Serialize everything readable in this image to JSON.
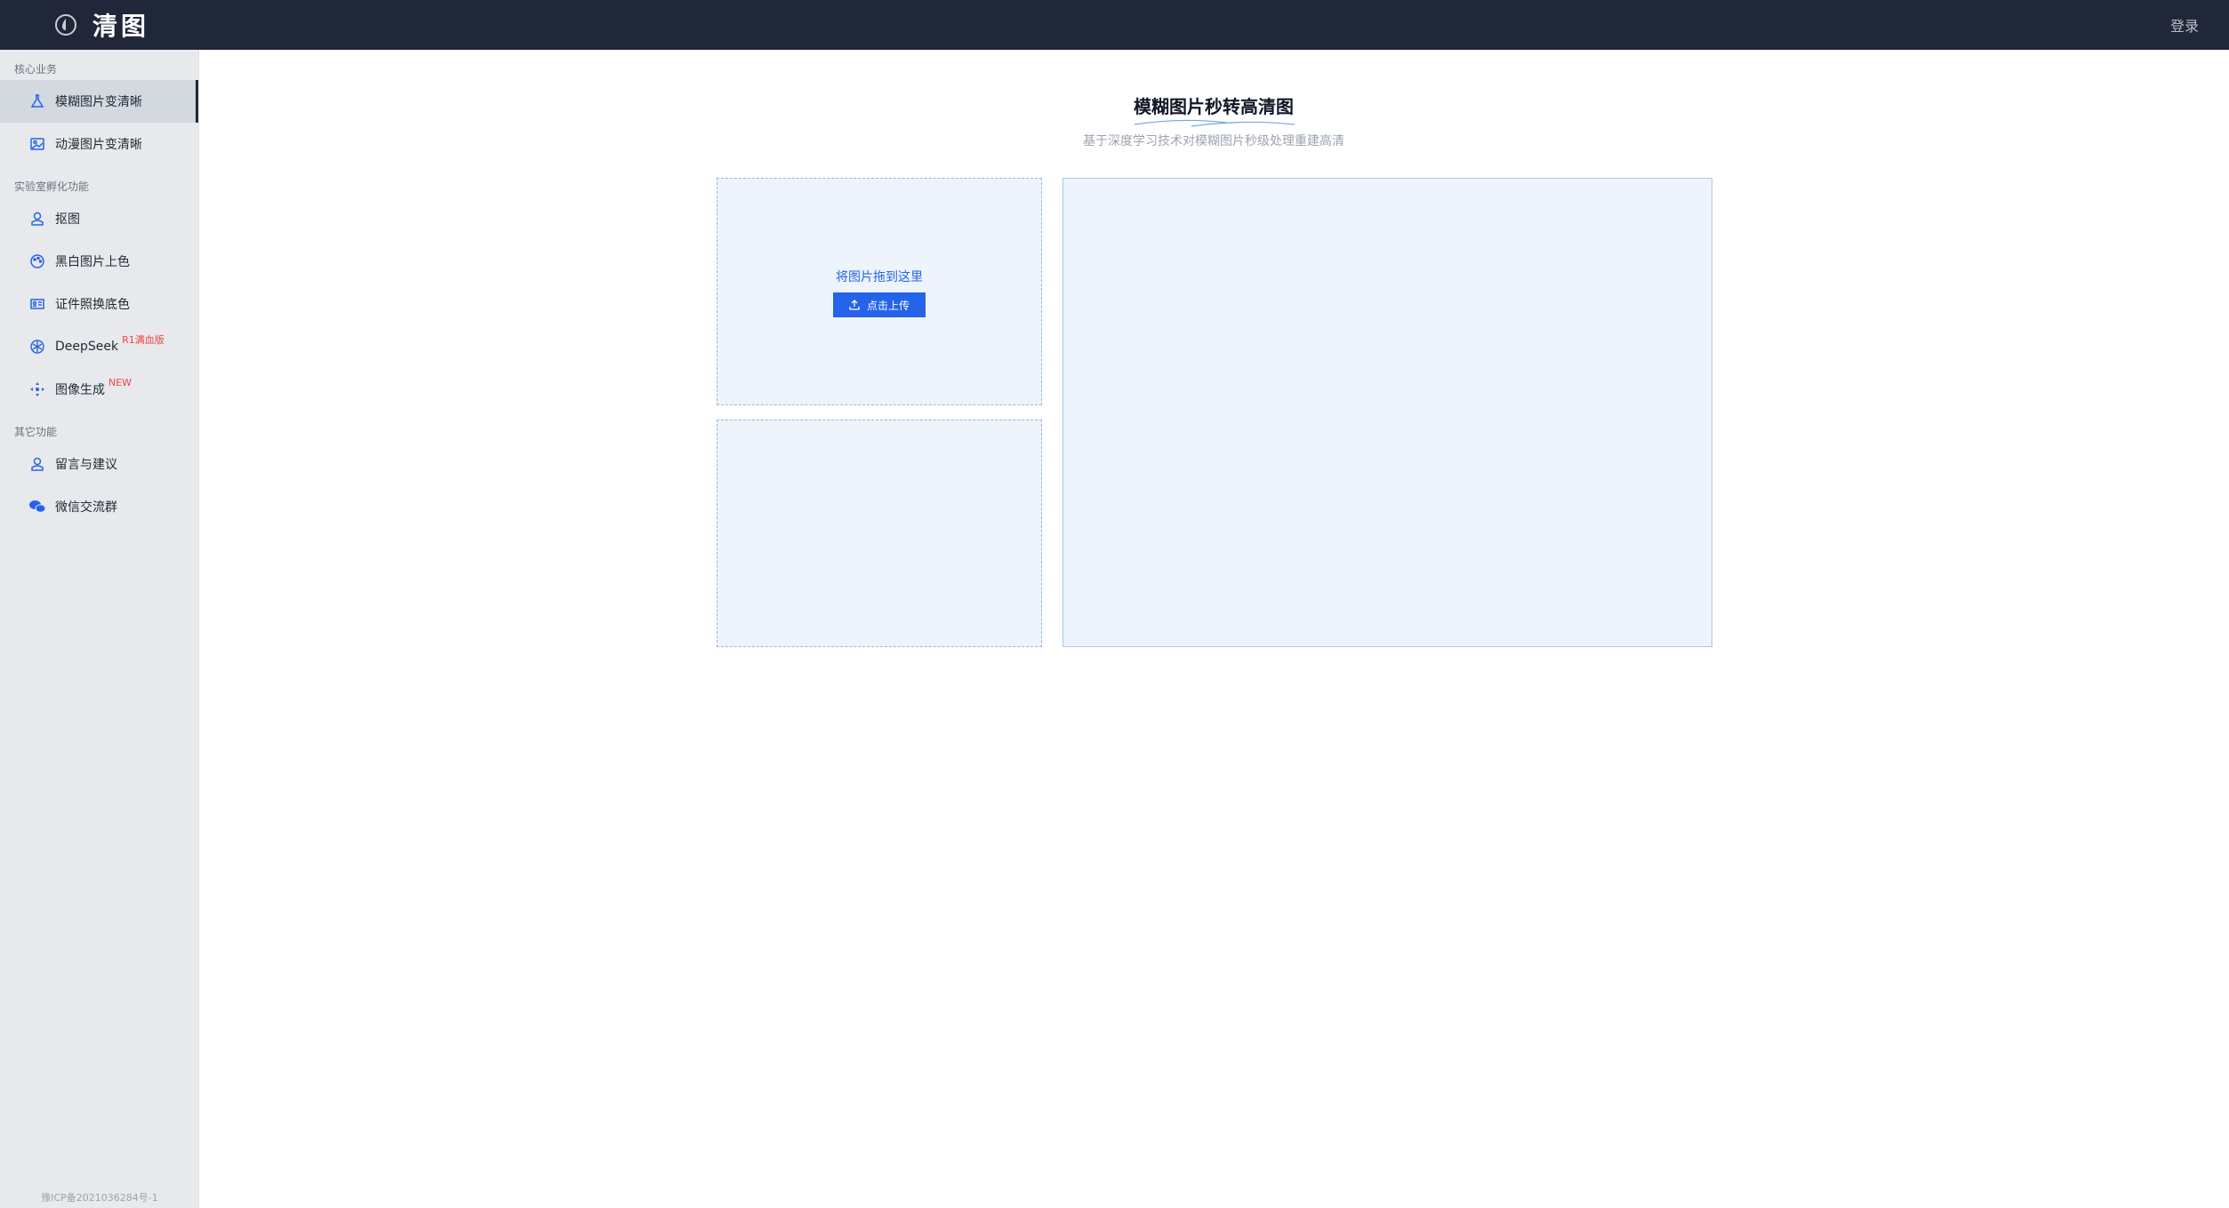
{
  "header": {
    "title": "清图",
    "login_label": "登录"
  },
  "sidebar": {
    "sections": [
      {
        "title": "核心业务",
        "items": [
          {
            "label": "模糊图片变清晰",
            "icon": "flask-icon",
            "active": true
          },
          {
            "label": "动漫图片变清晰",
            "icon": "image-icon"
          }
        ]
      },
      {
        "title": "实验室孵化功能",
        "items": [
          {
            "label": "抠图",
            "icon": "person-icon"
          },
          {
            "label": "黑白图片上色",
            "icon": "palette-icon"
          },
          {
            "label": "证件照换底色",
            "icon": "id-card-icon"
          },
          {
            "label": "DeepSeek",
            "icon": "openai-icon",
            "badge": "R1满血版"
          },
          {
            "label": "图像生成",
            "icon": "move-icon",
            "badge": "NEW"
          }
        ]
      },
      {
        "title": "其它功能",
        "items": [
          {
            "label": "留言与建议",
            "icon": "person-icon"
          },
          {
            "label": "微信交流群",
            "icon": "wechat-icon"
          }
        ]
      }
    ],
    "footer": "豫ICP备2021036284号-1"
  },
  "main": {
    "title": "模糊图片秒转高清图",
    "subtitle": "基于深度学习技术对模糊图片秒级处理重建高清",
    "upload": {
      "hint": "将图片拖到这里",
      "button_label": "点击上传"
    }
  },
  "colors": {
    "accent": "#2563eb",
    "topbar": "#1f2738",
    "badge": "#ef4444"
  }
}
